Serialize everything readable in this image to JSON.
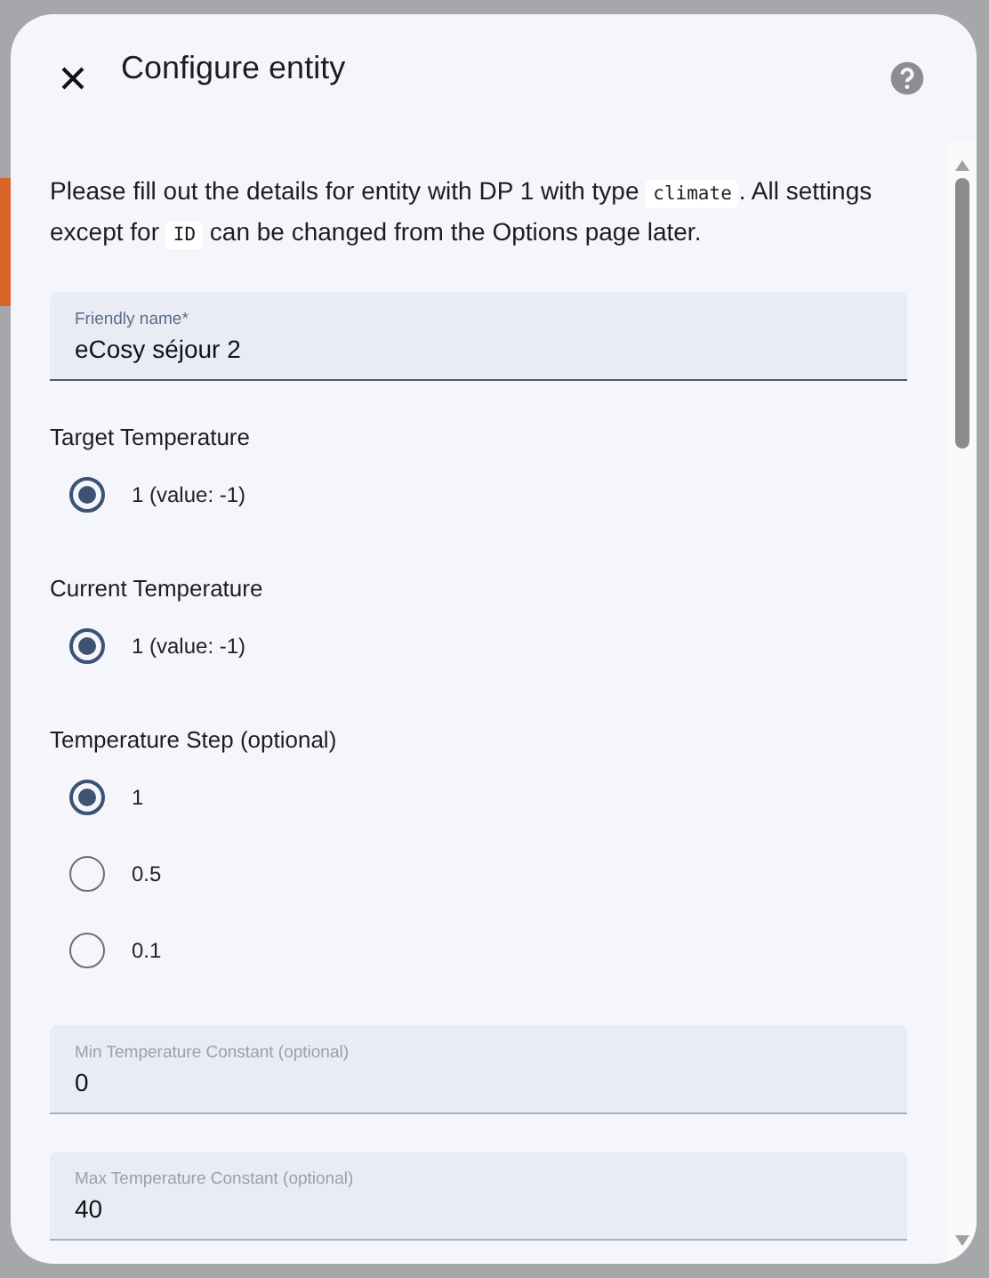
{
  "dialog": {
    "title": "Configure entity",
    "description": [
      {
        "kind": "text",
        "text": "Please fill out the details for entity with DP 1 with type "
      },
      {
        "kind": "code",
        "text": "climate"
      },
      {
        "kind": "text",
        "text": ". All settings except for "
      },
      {
        "kind": "code",
        "text": "ID"
      },
      {
        "kind": "text",
        "text": " can be changed from the Options page later."
      }
    ],
    "items": [
      {
        "kind": "field",
        "label": "Friendly name*",
        "value": "eCosy séjour 2",
        "focused": true
      },
      {
        "kind": "radios",
        "label": "Target Temperature",
        "options": [
          {
            "label": "1 (value: -1)",
            "selected": true
          }
        ]
      },
      {
        "kind": "radios",
        "label": "Current Temperature",
        "options": [
          {
            "label": "1 (value: -1)",
            "selected": true
          }
        ]
      },
      {
        "kind": "radios",
        "label": "Temperature Step (optional)",
        "options": [
          {
            "label": "1",
            "selected": true
          },
          {
            "label": "0.5",
            "selected": false
          },
          {
            "label": "0.1",
            "selected": false
          }
        ]
      },
      {
        "kind": "field",
        "label": "Min Temperature Constant (optional)",
        "value": "0",
        "focused": false
      },
      {
        "kind": "field",
        "label": "Max Temperature Constant (optional)",
        "value": "40",
        "focused": false
      }
    ]
  }
}
